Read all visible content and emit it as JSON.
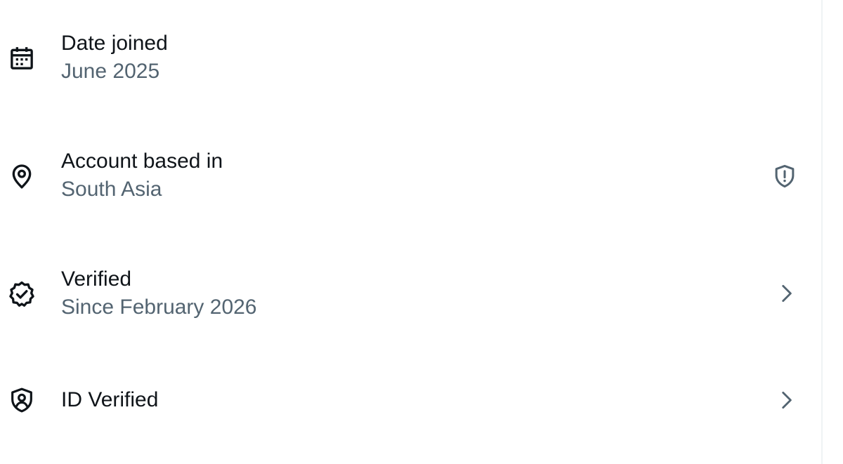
{
  "colors": {
    "primary_text": "#0f1419",
    "secondary_text": "#536471",
    "icon": "#0f1419",
    "trailing_icon": "#536471",
    "divider": "#eff3f4",
    "background": "#ffffff"
  },
  "rows": [
    {
      "icon": "calendar-icon",
      "title": "Date joined",
      "subtitle": "June 2025",
      "trailing": null
    },
    {
      "icon": "location-pin-icon",
      "title": "Account based in",
      "subtitle": "South Asia",
      "trailing": "shield-alert-icon"
    },
    {
      "icon": "verified-badge-icon",
      "title": "Verified",
      "subtitle": "Since February 2026",
      "trailing": "chevron-right-icon"
    },
    {
      "icon": "id-shield-icon",
      "title": "ID Verified",
      "subtitle": "",
      "trailing": "chevron-right-icon"
    }
  ]
}
